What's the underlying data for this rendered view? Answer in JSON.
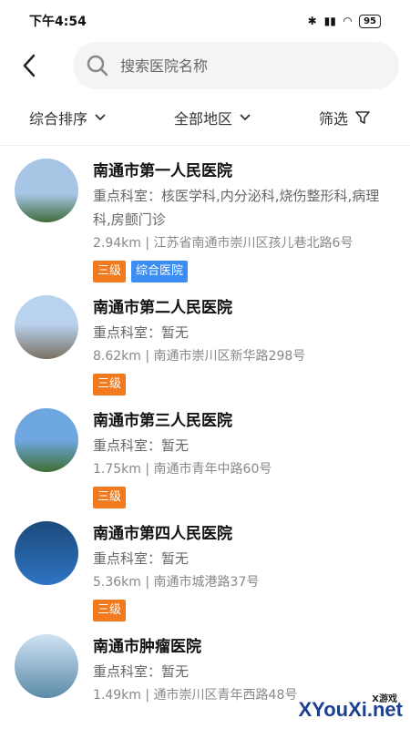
{
  "status": {
    "time": "下午4:54",
    "battery": "95"
  },
  "search": {
    "placeholder": "搜索医院名称"
  },
  "filters": {
    "sort": "综合排序",
    "region": "全部地区",
    "filter": "筛选"
  },
  "hospitals": [
    {
      "name": "南通市第一人民医院",
      "dept": "重点科室：核医学科,内分泌科,烧伤整形科,病理科,房颤门诊",
      "addr": "2.94km | 江苏省南通市崇川区孩儿巷北路6号",
      "level": "三级",
      "type": "综合医院",
      "colors": [
        "#a7c6e6",
        "#3f6b3a"
      ]
    },
    {
      "name": "南通市第二人民医院",
      "dept": "重点科室：暂无",
      "addr": "8.62km | 南通市崇川区新华路298号",
      "level": "三级",
      "type": "",
      "colors": [
        "#b9d3ef",
        "#7a6f62"
      ]
    },
    {
      "name": "南通市第三人民医院",
      "dept": "重点科室：暂无",
      "addr": "1.75km | 南通市青年中路60号",
      "level": "三级",
      "type": "",
      "colors": [
        "#6ea7e0",
        "#3e6e34"
      ]
    },
    {
      "name": "南通市第四人民医院",
      "dept": "重点科室：暂无",
      "addr": "5.36km | 南通市城港路37号",
      "level": "三级",
      "type": "",
      "colors": [
        "#1b4a7c",
        "#2f74c4"
      ]
    },
    {
      "name": "南通市肿瘤医院",
      "dept": "重点科室：暂无",
      "addr": "1.49km | 通市崇川区青年西路48号",
      "level": "",
      "type": "",
      "colors": [
        "#cfe3f3",
        "#5b8aa8"
      ]
    }
  ],
  "watermark": {
    "main": "XYouXi.net",
    "sub": "X游戏"
  }
}
